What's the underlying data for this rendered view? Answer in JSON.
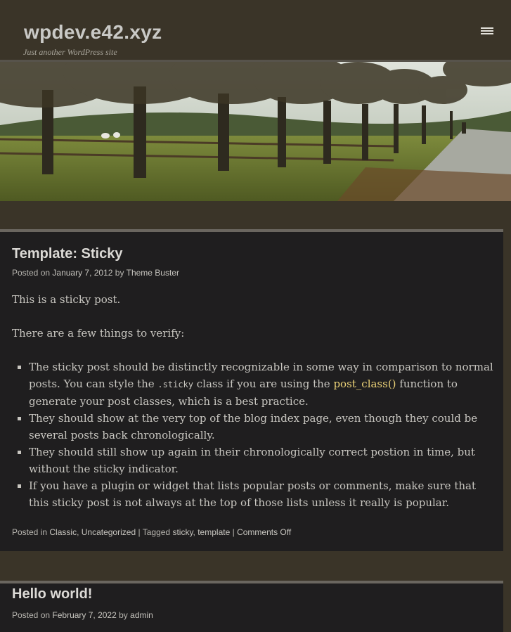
{
  "site": {
    "title": "wpdev.e42.xyz",
    "description": "Just another WordPress site"
  },
  "posts": [
    {
      "title": "Template: Sticky",
      "meta": {
        "posted_on": "Posted on",
        "date": "January 7, 2012",
        "by": "by",
        "author": "Theme Buster"
      },
      "intro": "This is a sticky post.",
      "verify": "There are a few things to verify:",
      "items": [
        {
          "a": "The sticky post should be distinctly recognizable in some way in comparison to normal posts. You can style the",
          "code": ".sticky",
          "b": "class if you are using the",
          "link": "post_class()",
          "c": "function to generate your post classes, which is a best practice."
        },
        {
          "text": "They should show at the very top of the blog index page, even though they could be several posts back chronologically."
        },
        {
          "text": "They should still show up again in their chronologically correct postion in time, but without the sticky indicator."
        },
        {
          "text": "If you have a plugin or widget that lists popular posts or comments, make sure that this sticky post is not always at the top of those lists unless it really is popular."
        }
      ],
      "footer": {
        "posted_in": "Posted in",
        "cat1": "Classic",
        "cat2": "Uncategorized",
        "tagged": "Tagged",
        "tag1": "sticky",
        "tag2": "template",
        "sep": "|",
        "comments": "Comments Off"
      }
    },
    {
      "title": "Hello world!",
      "meta": {
        "posted_on": "Posted on",
        "date": "February 7, 2022",
        "by": "by",
        "author": "admin"
      }
    }
  ],
  "colors": {
    "background": "#3a3428",
    "post_bg": "#1f1e1f",
    "link": "#ecd277",
    "text": "#c8c6c0"
  },
  "icons": {
    "menu": "hamburger-menu-icon"
  }
}
